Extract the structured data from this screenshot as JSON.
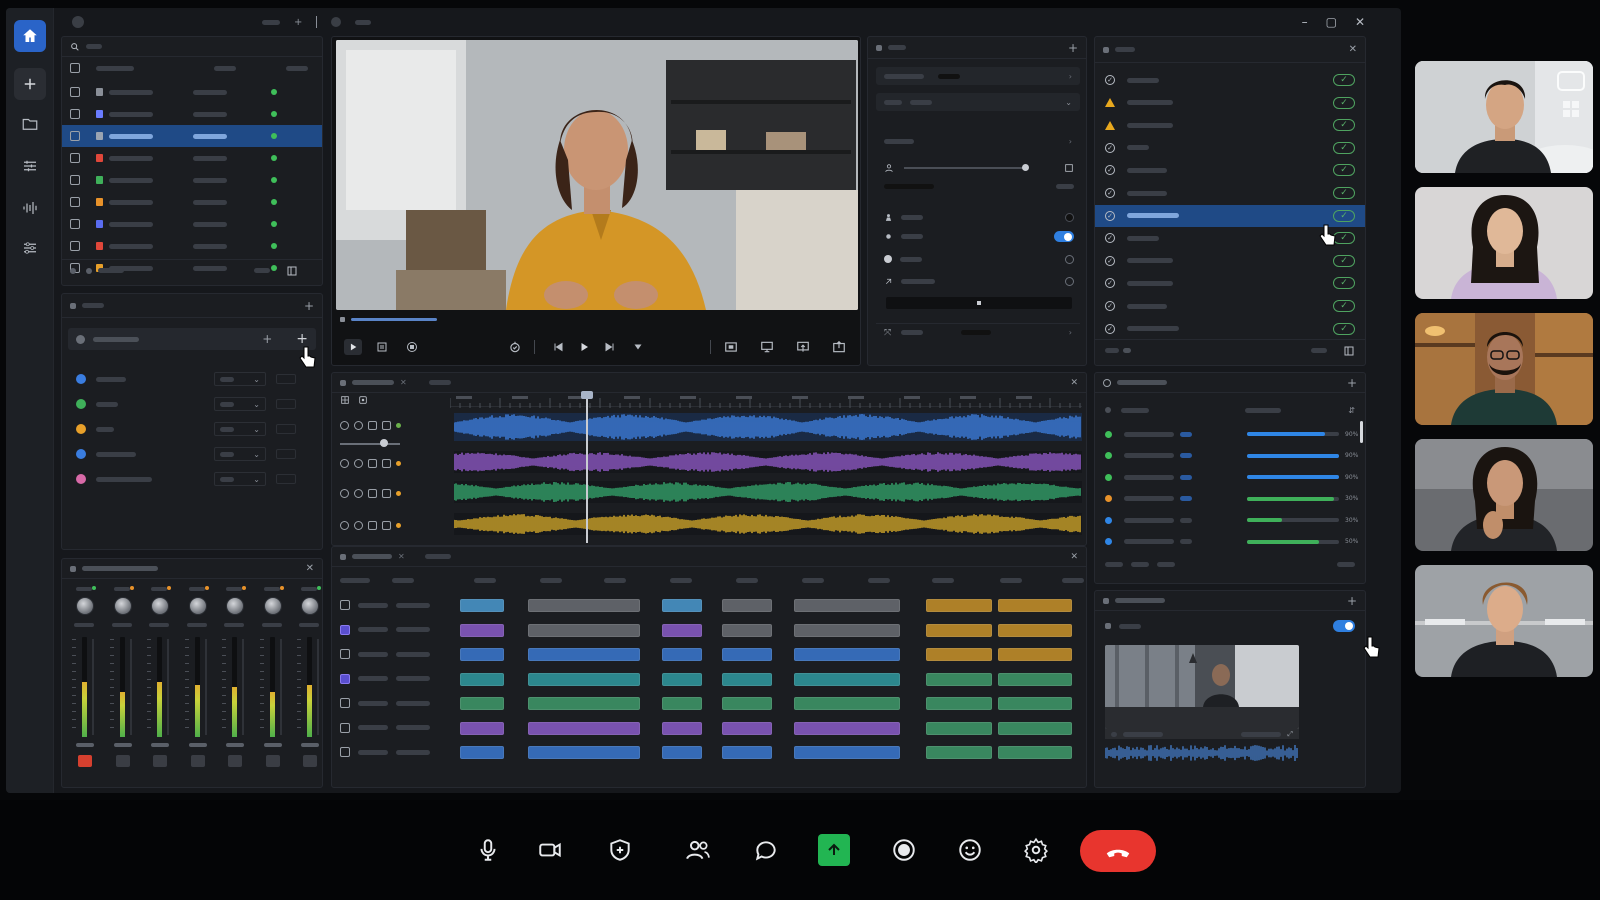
{
  "app": {
    "title_bar": [
      "window-controls"
    ],
    "video_main": {
      "description_hidden": true
    }
  },
  "file_list": {
    "rows": [
      {
        "color": "#8a8f98",
        "status": "#3fbf5a",
        "selected": false
      },
      {
        "color": "#6a7cff",
        "status": "#3fbf5a",
        "selected": false
      },
      {
        "color": "#9aa4b2",
        "status": "#3fbf5a",
        "selected": true
      },
      {
        "color": "#e0473a",
        "status": "#3fbf5a",
        "selected": false
      },
      {
        "color": "#3fb05a",
        "status": "#3fbf5a",
        "selected": false
      },
      {
        "color": "#e8922a",
        "status": "#3fbf5a",
        "selected": false
      },
      {
        "color": "#5a6cf0",
        "status": "#3fbf5a",
        "selected": false
      },
      {
        "color": "#e0473a",
        "status": "#3fbf5a",
        "selected": false
      },
      {
        "color": "#e8a02a",
        "status": "#3fbf5a",
        "selected": false
      }
    ]
  },
  "tracks_panel": {
    "items": [
      {
        "color": "#3a7de0"
      },
      {
        "color": "#3fb05a"
      },
      {
        "color": "#e8a02a"
      },
      {
        "color": "#3a7de0"
      },
      {
        "color": "#d86aa8"
      }
    ]
  },
  "waveforms": {
    "colors": [
      "#3f83e6",
      "#9b5fd6",
      "#37b072",
      "#e2b32a"
    ],
    "playhead_fraction": 0.21
  },
  "checklist": {
    "rows": [
      {
        "icon": "check-circle-icon"
      },
      {
        "icon": "warning-icon"
      },
      {
        "icon": "warning-icon"
      },
      {
        "icon": "check-circle-icon"
      },
      {
        "icon": "check-circle-icon"
      },
      {
        "icon": "check-circle-icon"
      },
      {
        "icon": "check-circle-icon",
        "selected": true
      },
      {
        "icon": "check-circle-icon"
      },
      {
        "icon": "check-circle-icon"
      },
      {
        "icon": "check-circle-icon"
      },
      {
        "icon": "check-circle-icon"
      },
      {
        "icon": "check-circle-icon"
      }
    ],
    "accent": "#4fa360",
    "warning": "#e8a81e"
  },
  "progress_list": {
    "rows": [
      {
        "dot": "#3fbf5a",
        "level": 0.85,
        "color": "#2f86e6",
        "label": "90%"
      },
      {
        "dot": "#3fbf5a",
        "level": 1.0,
        "color": "#2f86e6",
        "label": "90%"
      },
      {
        "dot": "#3fbf5a",
        "level": 1.0,
        "color": "#2f86e6",
        "label": "90%"
      },
      {
        "dot": "#e8922a",
        "level": 0.95,
        "color": "#3fb05a",
        "label": "30%"
      },
      {
        "dot": "#2f86e6",
        "level": 0.38,
        "color": "#3fb05a",
        "label": "30%"
      },
      {
        "dot": "#2f86e6",
        "level": 0.78,
        "color": "#3fb05a",
        "label": "50%"
      }
    ]
  },
  "mixer": {
    "meter_levels": [
      0.55,
      0.45,
      0.55,
      0.52,
      0.5,
      0.45,
      0.52
    ],
    "meter_color": "#c8d23a"
  },
  "timeline_tracks": {
    "row_colors": [
      "#4a9ad0",
      "#8a5cc8",
      "#3a78d0",
      "#2f9aa0",
      "#3f9a6a",
      "#8a5cc8",
      "#3a78d0"
    ]
  },
  "callbar": {
    "share_color": "#22b552",
    "end_call_color": "#e8352e"
  }
}
